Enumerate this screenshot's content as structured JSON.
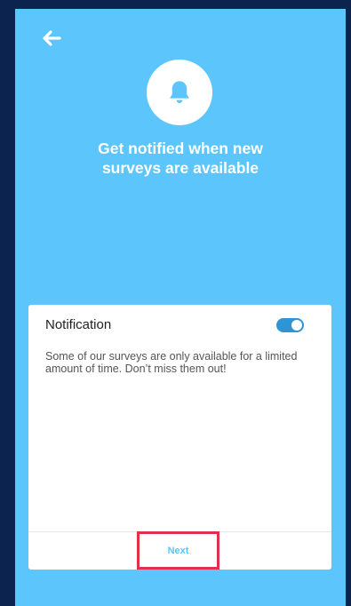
{
  "header": {
    "back_icon": "arrow-left-icon",
    "hero_icon": "bell-icon",
    "title_line1": "Get notified when new",
    "title_line2": "surveys are available"
  },
  "card": {
    "title": "Notification",
    "toggle_on": true,
    "description": "Some of our surveys are only available for a limited amount of time. Don’t miss them out!",
    "next_label": "Next"
  },
  "colors": {
    "background": "#5cc5fc",
    "outer": "#0c2350",
    "toggle": "#2e94d3",
    "highlight": "#e0314a"
  }
}
